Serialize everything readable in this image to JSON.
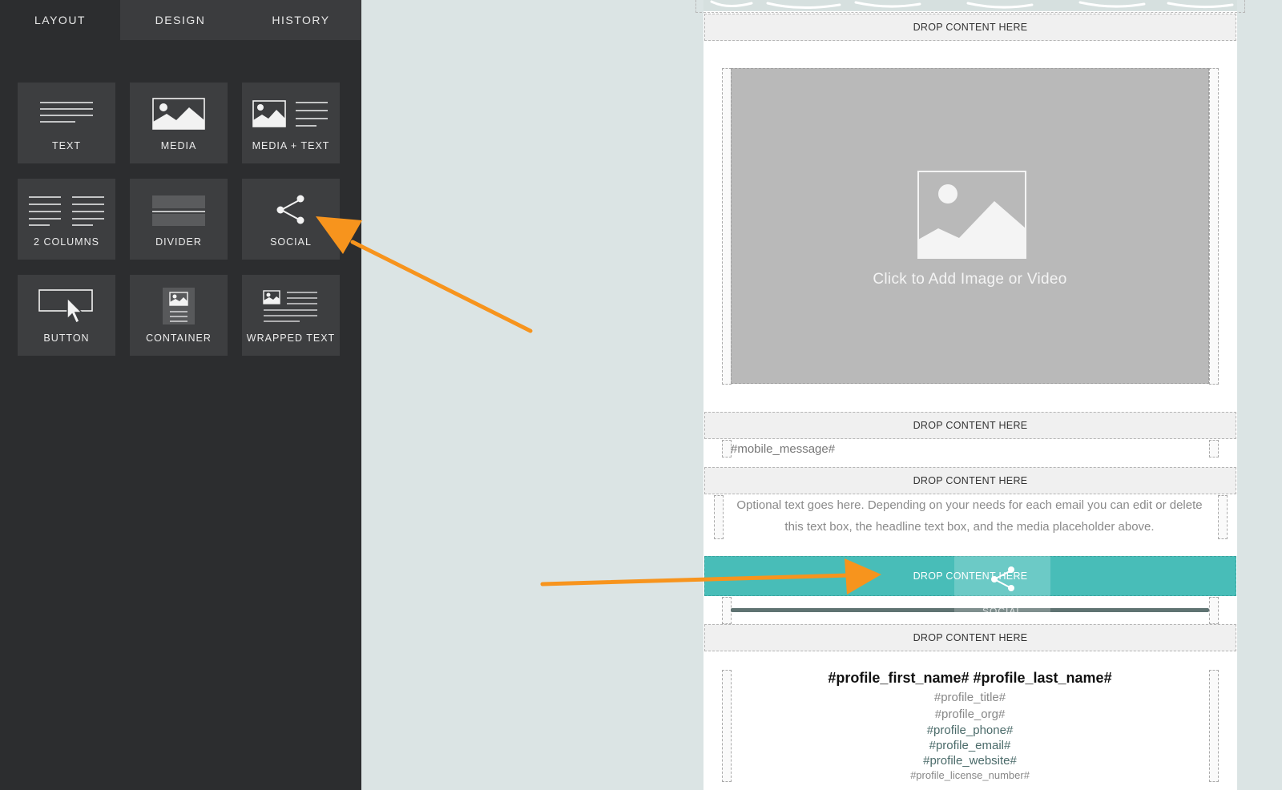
{
  "sidebar": {
    "tabs": [
      {
        "label": "LAYOUT"
      },
      {
        "label": "DESIGN"
      },
      {
        "label": "HISTORY"
      }
    ],
    "tiles": [
      {
        "label": "TEXT",
        "icon": "text-lines-icon"
      },
      {
        "label": "MEDIA",
        "icon": "image-icon"
      },
      {
        "label": "MEDIA + TEXT",
        "icon": "image-text-icon"
      },
      {
        "label": "2 COLUMNS",
        "icon": "columns-icon"
      },
      {
        "label": "DIVIDER",
        "icon": "divider-icon"
      },
      {
        "label": "SOCIAL",
        "icon": "share-icon"
      },
      {
        "label": "BUTTON",
        "icon": "button-cursor-icon"
      },
      {
        "label": "CONTAINER",
        "icon": "container-icon"
      },
      {
        "label": "WRAPPED TEXT",
        "icon": "wrapped-text-icon"
      }
    ]
  },
  "canvas": {
    "drop_label": "DROP CONTENT HERE",
    "media_placeholder": "Click to Add Image or Video",
    "mobile_message": "#mobile_message#",
    "optional_text": "Optional text goes here.  Depending on your needs for each email you can edit or delete this text box, the headline text box, and the media placeholder above.",
    "drag_ghost_label": "SOCIAL",
    "profile": {
      "name": "#profile_first_name# #profile_last_name#",
      "title": "#profile_title#",
      "org": "#profile_org#",
      "phone": "#profile_phone#",
      "email": "#profile_email#",
      "website": "#profile_website#",
      "license": "#profile_license_number#"
    }
  },
  "colors": {
    "sidebar_bg": "#2c2d2f",
    "tile_bg": "#3d3e40",
    "canvas_bg": "#dbe4e4",
    "active_drop": "#48bdb8",
    "arrow": "#f7941d"
  }
}
